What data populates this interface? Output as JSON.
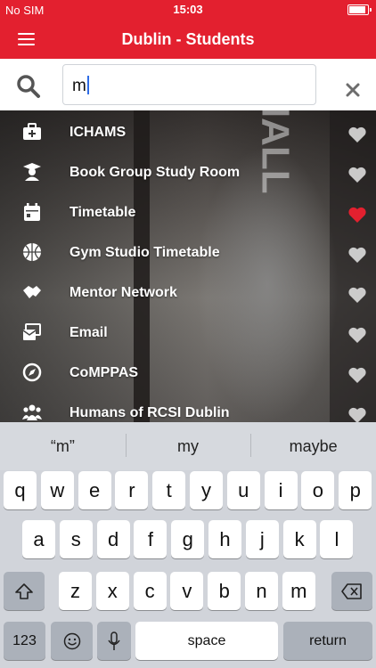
{
  "status_bar": {
    "carrier": "No SIM",
    "time": "15:03",
    "battery_level": 0.9
  },
  "nav_bar": {
    "title": "Dublin - Students",
    "menu_icon": "hamburger-menu-icon"
  },
  "search": {
    "value": "m",
    "search_icon": "magnifier-icon",
    "clear_icon": "close-x-icon"
  },
  "background_text": "HALL",
  "results": [
    {
      "label": "ICHAMS",
      "icon": "medical-kit-icon",
      "favorite": false
    },
    {
      "label": "Book Group Study Room",
      "icon": "graduate-icon",
      "favorite": false
    },
    {
      "label": "Timetable",
      "icon": "calendar-icon",
      "favorite": true
    },
    {
      "label": "Gym Studio Timetable",
      "icon": "basketball-icon",
      "favorite": false
    },
    {
      "label": "Mentor Network",
      "icon": "handshake-icon",
      "favorite": false
    },
    {
      "label": "Email",
      "icon": "mail-icon",
      "favorite": false
    },
    {
      "label": "CoMPPAS",
      "icon": "compass-icon",
      "favorite": false
    },
    {
      "label": "Humans of RCSI Dublin",
      "icon": "people-group-icon",
      "favorite": false
    }
  ],
  "colors": {
    "brand": "#e3202f",
    "favorite_active": "#e3202f",
    "favorite_inactive": "#e6e6e6"
  },
  "keyboard": {
    "suggestions": [
      "“m”",
      "my",
      "maybe"
    ],
    "row1": [
      "q",
      "w",
      "e",
      "r",
      "t",
      "y",
      "u",
      "i",
      "o",
      "p"
    ],
    "row2": [
      "a",
      "s",
      "d",
      "f",
      "g",
      "h",
      "j",
      "k",
      "l"
    ],
    "row3": [
      "z",
      "x",
      "c",
      "v",
      "b",
      "n",
      "m"
    ],
    "numbers_key": "123",
    "space_key": "space",
    "return_key": "return"
  }
}
